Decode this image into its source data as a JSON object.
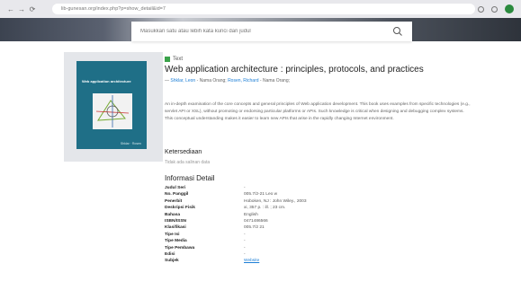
{
  "browser": {
    "back": "←",
    "forward": "→",
    "reload": "⟳",
    "url": "lib-gunesan.org/index.php?p=show_detail&id=7"
  },
  "search": {
    "placeholder": "Masukkan satu atau lebih kata kunci dari judul"
  },
  "book_cover": {
    "title": "Web application architecture",
    "author": "Shklar · Rosen"
  },
  "item": {
    "type_label": "Text",
    "title": "Web application architecture : principles, protocols, and practices",
    "author_prefix": "— ",
    "author1": "Shklar, Leon",
    "author1_role": " - Nama Orang; ",
    "author2": "Rosen, Richard",
    "author2_role": " - Nama Orang;",
    "abstract": "An in-depth examination of the core concepts and general principles of Web application development. This book uses examples from specific technologies (e.g., servlet API or XSL), without promoting or endorsing particular platforms or APIs. Such knowledge is critical when designing and debugging complex systems. This conceptual understanding makes it easier to learn new APIs that arise in the rapidly changing Internet environment."
  },
  "availability": {
    "heading": "Ketersediaan",
    "note": "Tidak ada salinan data"
  },
  "details": {
    "heading": "Informasi Detail",
    "rows": [
      {
        "label": "Judul Seri",
        "value": "-"
      },
      {
        "label": "No. Panggil",
        "value": "005.7/2-21 Leo w"
      },
      {
        "label": "Penerbit",
        "value": "Hoboken, NJ : John Wiley., 2003"
      },
      {
        "label": "Deskripsi Fisik",
        "value": "xi, 357 p. : ill. ; 23 cm."
      },
      {
        "label": "Bahasa",
        "value": "English"
      },
      {
        "label": "ISBN/ISSN",
        "value": "0471486566"
      },
      {
        "label": "Klasifikasi",
        "value": "005.7/2 21"
      },
      {
        "label": "Tipe Isi",
        "value": "-"
      },
      {
        "label": "Tipe Media",
        "value": "-"
      },
      {
        "label": "Tipe Pembawa",
        "value": "-"
      },
      {
        "label": "Edisi",
        "value": "-"
      },
      {
        "label": "Subjek",
        "value": "Website"
      }
    ]
  },
  "colors": {
    "link": "#1c7ed6",
    "type_badge": "#3aa24a",
    "book_cover": "#1f6f87"
  }
}
